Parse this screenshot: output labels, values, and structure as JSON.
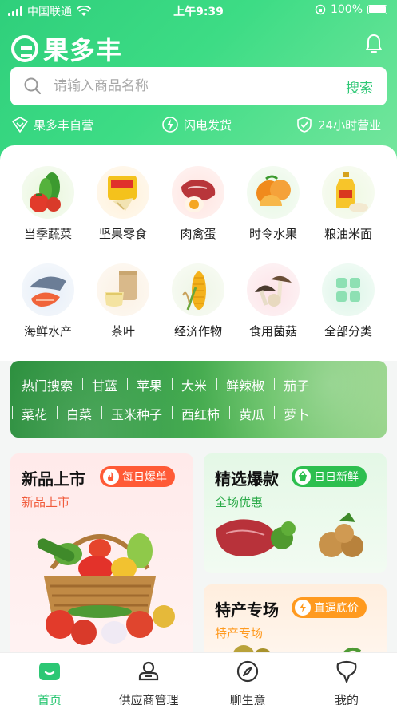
{
  "status_bar": {
    "carrier": "中国联通",
    "time": "上午9:39",
    "battery": "100%"
  },
  "app": {
    "logo_text": "果多丰"
  },
  "search": {
    "placeholder": "请输入商品名称",
    "button_label": "搜索"
  },
  "features": [
    {
      "label": "果多丰自营",
      "icon": "shield-heart-icon"
    },
    {
      "label": "闪电发货",
      "icon": "lightning-icon"
    },
    {
      "label": "24小时营业",
      "icon": "shield-check-icon"
    }
  ],
  "categories": [
    {
      "label": "当季蔬菜",
      "icon": "vegetables-icon"
    },
    {
      "label": "坚果零食",
      "icon": "snacks-icon"
    },
    {
      "label": "肉禽蛋",
      "icon": "meat-egg-icon"
    },
    {
      "label": "时令水果",
      "icon": "fruit-icon"
    },
    {
      "label": "粮油米面",
      "icon": "grain-oil-icon"
    },
    {
      "label": "海鲜水产",
      "icon": "seafood-icon"
    },
    {
      "label": "茶叶",
      "icon": "tea-icon"
    },
    {
      "label": "经济作物",
      "icon": "crop-icon"
    },
    {
      "label": "食用菌菇",
      "icon": "mushroom-icon"
    },
    {
      "label": "全部分类",
      "icon": "all-categories-icon"
    }
  ],
  "hot_search": {
    "title": "热门搜索",
    "row1": [
      "甘蓝",
      "苹果",
      "大米",
      "鲜辣椒",
      "茄子"
    ],
    "row2": [
      "菜花",
      "白菜",
      "玉米种子",
      "西红柿",
      "黄瓜",
      "萝卜"
    ]
  },
  "promos": {
    "new": {
      "title": "新品上市",
      "tag": "每日爆单",
      "subtitle": "新品上市",
      "tag_color": "#ff5a36",
      "sub_color": "#f05a3a"
    },
    "best": {
      "title": "精选爆款",
      "tag": "日日新鲜",
      "subtitle": "全场优惠",
      "tag_color": "#2dbf4f",
      "sub_color": "#2aaa48"
    },
    "special": {
      "title": "特产专场",
      "tag": "直逼底价",
      "subtitle": "特产专场",
      "tag_color": "#ff9a1f",
      "sub_color": "#ff9a1f"
    }
  },
  "tabs": [
    {
      "label": "首页",
      "icon": "home-icon",
      "active": true
    },
    {
      "label": "供应商管理",
      "icon": "supplier-icon",
      "active": false
    },
    {
      "label": "聊生意",
      "icon": "compass-icon",
      "active": false
    },
    {
      "label": "我的",
      "icon": "profile-icon",
      "active": false
    }
  ],
  "colors": {
    "brand_green": "#2cc774",
    "header_gradient_start": "#2fcf7b",
    "header_gradient_end": "#77e69e"
  }
}
